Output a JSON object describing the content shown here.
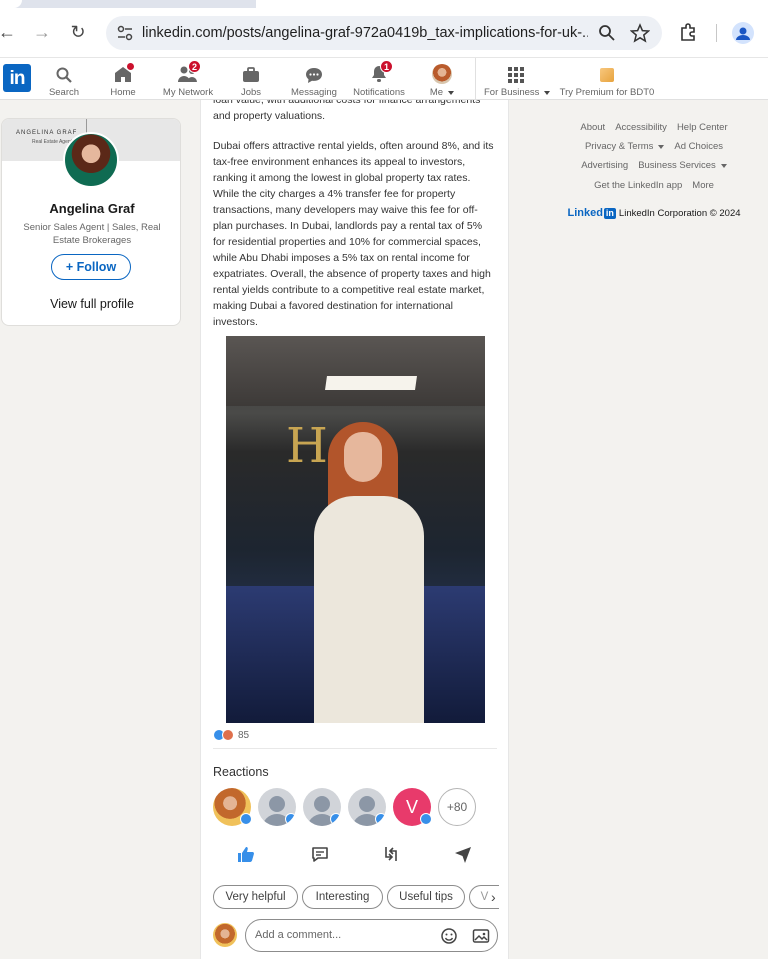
{
  "browser": {
    "url": "linkedin.com/posts/angelina-graf-972a0419b_tax-implications-for-uk-...",
    "back_icon": "←",
    "forward_icon": "→",
    "reload_icon": "↻"
  },
  "nav": {
    "search": "Search",
    "home": "Home",
    "my_network": "My Network",
    "my_network_badge": "2",
    "jobs": "Jobs",
    "messaging": "Messaging",
    "notifications": "Notifications",
    "notifications_badge": "1",
    "me": "Me",
    "for_business": "For Business",
    "premium": "Try Premium for BDT0"
  },
  "profile": {
    "banner_name": "ANGELINA GRAF",
    "banner_sub": "Real Estate Agent",
    "name": "Angelina Graf",
    "title": "Senior Sales Agent | Sales, Real Estate Brokerages",
    "follow": "Follow",
    "view_profile": "View full profile"
  },
  "post": {
    "para0": "loan value, with additional costs for finance arrangements and property valuations.",
    "para1": "Dubai offers attractive rental yields, often around 8%, and its tax-free environment enhances its appeal to investors, ranking it among the lowest in global property tax rates. While the city charges a 4% transfer fee for property transactions, many developers may waive this fee for off-plan purchases. In Dubai, landlords pay a rental tax of 5% for residential properties and 10% for commercial spaces, while Abu Dhabi imposes a 5% tax on rental income for expatriates. Overall, the absence of property taxes and high rental yields contribute to a competitive real estate market, making Dubai a favored destination for international investors.",
    "photo_sign": "HS",
    "reaction_count": "85",
    "reactions_title": "Reactions",
    "more_reactors": "+80",
    "reactor_initial": "V",
    "chips": [
      "Very helpful",
      "Interesting",
      "Useful tips",
      "V"
    ],
    "comment_placeholder": "Add a comment..."
  },
  "footer": {
    "about": "About",
    "accessibility": "Accessibility",
    "help": "Help Center",
    "privacy": "Privacy & Terms",
    "adchoices": "Ad Choices",
    "advertising": "Advertising",
    "business": "Business Services",
    "app": "Get the LinkedIn app",
    "more": "More",
    "brand": "Linked",
    "brand_in": "in",
    "copyright": "LinkedIn Corporation © 2024"
  },
  "colors": {
    "brand": "#0a66c2",
    "badge": "#cb112d",
    "page_bg": "#f3f2ef"
  }
}
